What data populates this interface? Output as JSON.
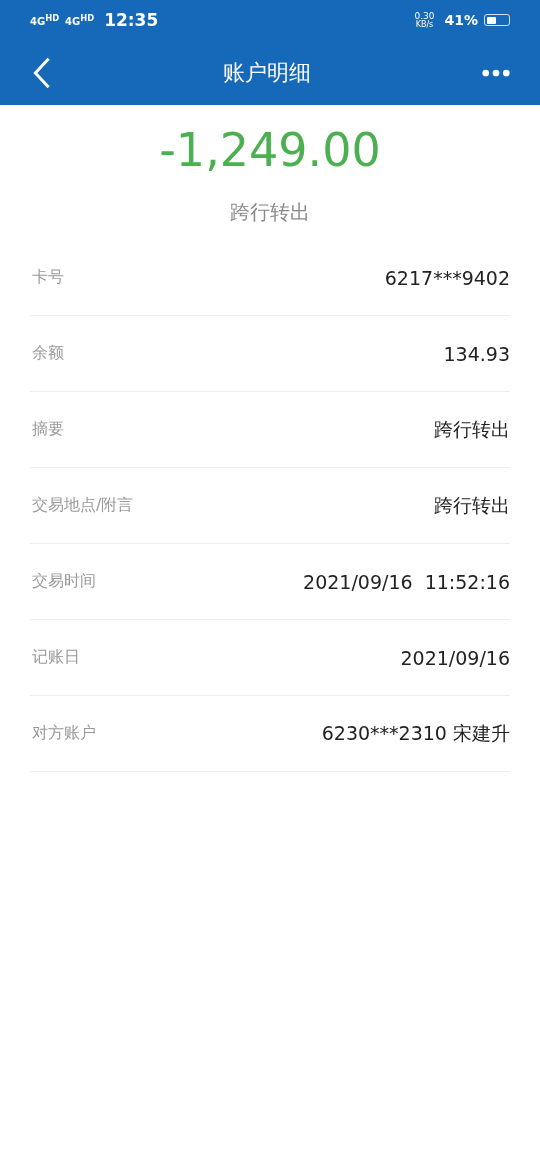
{
  "status_bar": {
    "signals": [
      "4G$^{HD}$",
      "4G$^{HD}$"
    ],
    "time": "12:35",
    "net_speed": "0.30",
    "net_unit": "KB/s",
    "battery": "41%"
  },
  "header": {
    "title": "账户明细"
  },
  "amount": "-1,249.00",
  "type": "跨行转出",
  "rows": [
    {
      "label": "卡号",
      "value": "6217***9402"
    },
    {
      "label": "余额",
      "value": "134.93"
    },
    {
      "label": "摘要",
      "value": "跨行转出"
    },
    {
      "label": "交易地点/附言",
      "value": "跨行转出"
    },
    {
      "label": "交易时间",
      "value": "2021/09/16  11:52:16"
    },
    {
      "label": "记账日",
      "value": "2021/09/16"
    },
    {
      "label": "对方账户",
      "value": "6230***2310 宋建升"
    }
  ]
}
